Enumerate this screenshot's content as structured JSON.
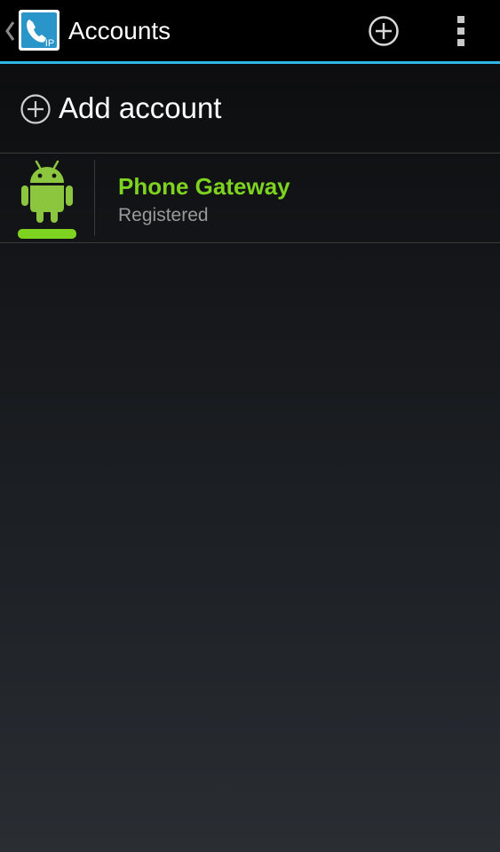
{
  "app": {
    "title": "Accounts",
    "app_icon_text": "IP",
    "accent_color": "#33b5e5"
  },
  "action_bar": {
    "add_icon": "add-circle-icon",
    "overflow_icon": "overflow-menu-icon"
  },
  "add_account": {
    "label": "Add account",
    "icon": "add-circle-icon"
  },
  "accounts": [
    {
      "name": "Phone Gateway",
      "status": "Registered",
      "avatar_icon": "android-icon",
      "name_color": "#7ed320",
      "status_color": "#7ed320"
    }
  ]
}
